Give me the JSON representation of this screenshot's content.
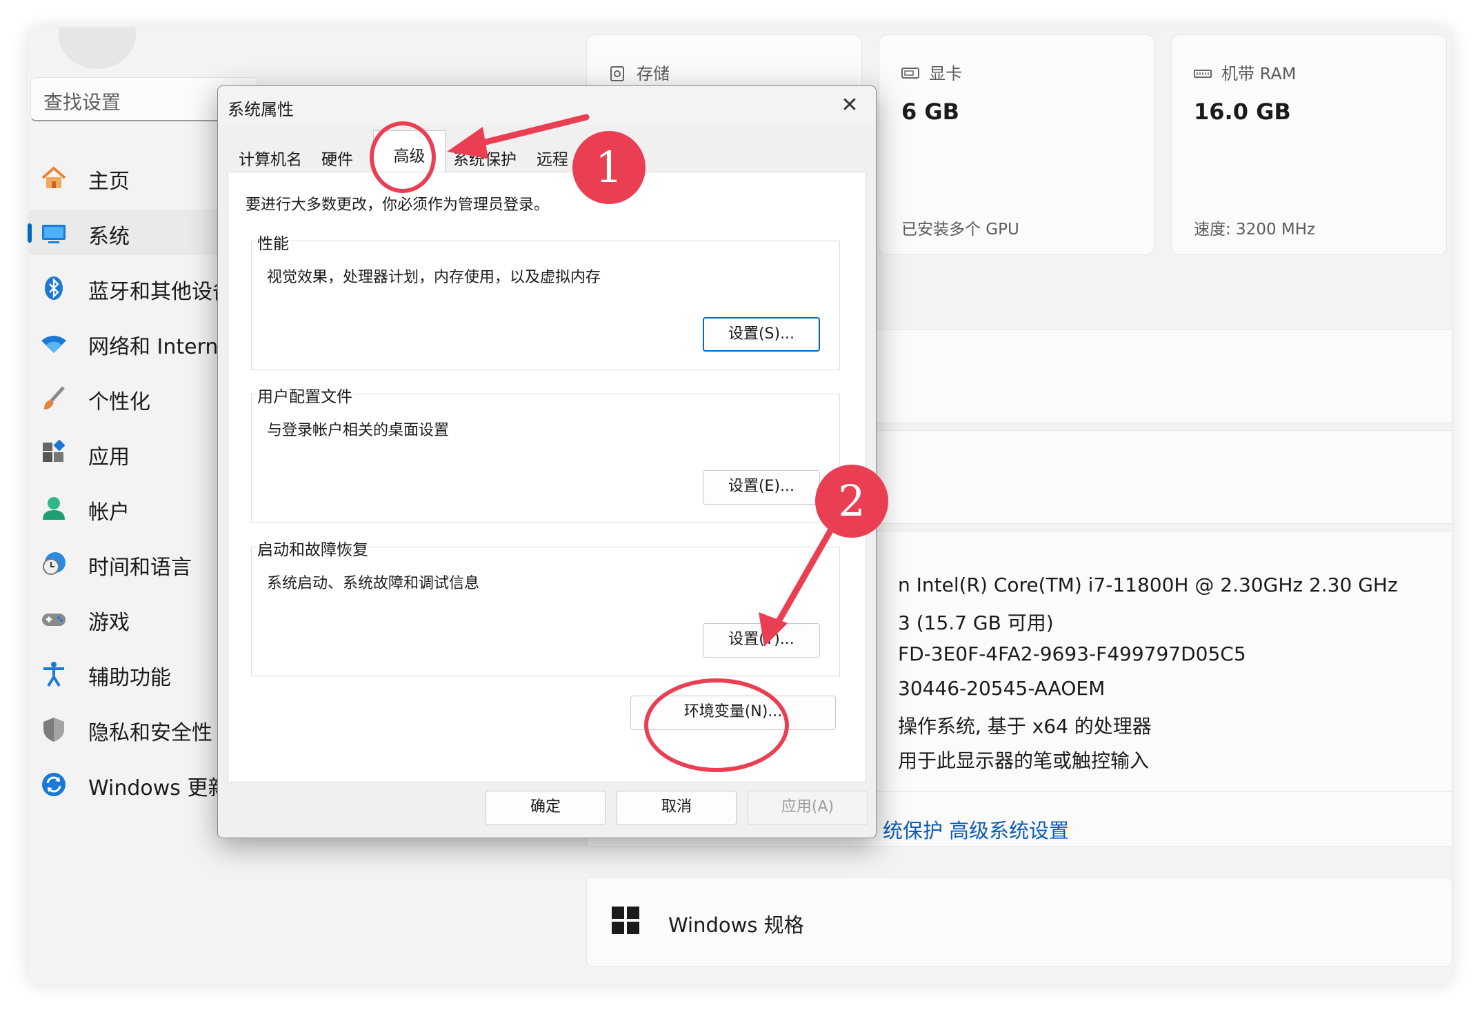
{
  "settings": {
    "search_placeholder": "查找设置",
    "nav": [
      {
        "label": "主页",
        "icon": "home-icon"
      },
      {
        "label": "系统",
        "icon": "system-display-icon",
        "active": true
      },
      {
        "label": "蓝牙和其他设备",
        "icon": "bluetooth-icon"
      },
      {
        "label": "网络和 Internet",
        "icon": "wifi-icon"
      },
      {
        "label": "个性化",
        "icon": "brush-icon"
      },
      {
        "label": "应用",
        "icon": "apps-icon"
      },
      {
        "label": "帐户",
        "icon": "account-icon"
      },
      {
        "label": "时间和语言",
        "icon": "globe-clock-icon"
      },
      {
        "label": "游戏",
        "icon": "gamepad-icon"
      },
      {
        "label": "辅助功能",
        "icon": "accessibility-icon"
      },
      {
        "label": "隐私和安全性",
        "icon": "shield-icon"
      },
      {
        "label": "Windows 更新",
        "icon": "update-icon"
      }
    ],
    "cards": {
      "storage": {
        "title": "存储",
        "icon": "storage-icon"
      },
      "gpu": {
        "title": "显卡",
        "value": "6 GB",
        "sub": "已安装多个 GPU",
        "icon": "gpu-icon"
      },
      "ram": {
        "title": "机带 RAM",
        "value": "16.0 GB",
        "sub": "速度: 3200 MHz",
        "icon": "ram-icon"
      }
    },
    "specs": [
      "n Intel(R) Core(TM) i7-11800H @ 2.30GHz   2.30 GHz",
      "3 (15.7 GB 可用)",
      "FD-3E0F-4FA2-9693-F499797D05C5",
      "30446-20545-AAOEM",
      "操作系统, 基于 x64 的处理器",
      "用于此显示器的笔或触控输入"
    ],
    "related_links": {
      "protection": "统保护",
      "advanced": "高级系统设置"
    },
    "windows_spec_title": "Windows 规格"
  },
  "dialog": {
    "title": "系统属性",
    "close": "✕",
    "tabs": [
      "计算机名",
      "硬件",
      "高级",
      "系统保护",
      "远程"
    ],
    "active_tab": "高级",
    "intro": "要进行大多数更改，你必须作为管理员登录。",
    "groups": {
      "performance": {
        "title": "性能",
        "desc": "视觉效果，处理器计划，内存使用，以及虚拟内存",
        "button": "设置(S)..."
      },
      "profile": {
        "title": "用户配置文件",
        "desc": "与登录帐户相关的桌面设置",
        "button": "设置(E)..."
      },
      "startup": {
        "title": "启动和故障恢复",
        "desc": "系统启动、系统故障和调试信息",
        "button": "设置(T)..."
      }
    },
    "env_button": "环境变量(N)...",
    "ok": "确定",
    "cancel": "取消",
    "apply": "应用(A)"
  },
  "annotations": {
    "step1": "1",
    "step2": "2",
    "color": "#ea3f53"
  },
  "colors": {
    "accent": "#0067c0",
    "link": "#0a5cb8",
    "annotation": "#ea3f53"
  }
}
